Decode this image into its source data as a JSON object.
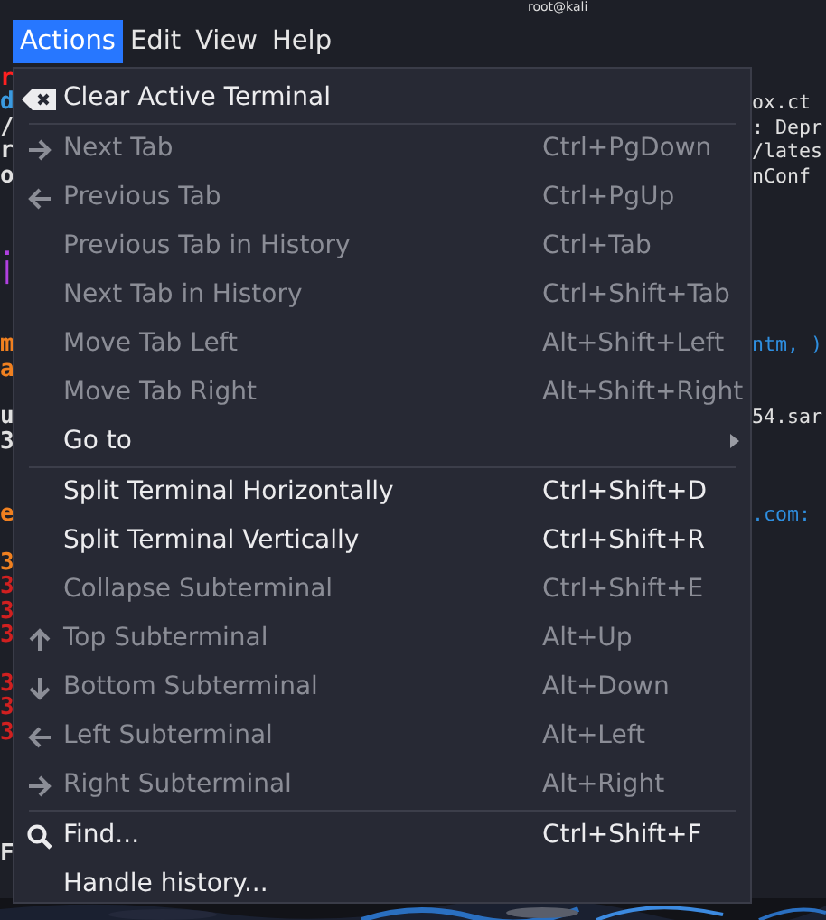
{
  "window": {
    "title": "root@kali"
  },
  "menubar": [
    {
      "label": "Actions",
      "selected": true
    },
    {
      "label": "Edit",
      "selected": false
    },
    {
      "label": "View",
      "selected": false
    },
    {
      "label": "Help",
      "selected": false
    }
  ],
  "terminal_left": [
    {
      "text": "r",
      "color": "#ff2020"
    },
    {
      "text": "d",
      "color": "#3b9ae0"
    },
    {
      "text": "/",
      "color": "#e0e0e0"
    },
    {
      "text": "r",
      "color": "#e0e0e0"
    },
    {
      "text": "o",
      "color": "#e0e0e0"
    },
    {
      "text": ".",
      "color": "#b040e0"
    },
    {
      "text": "|",
      "color": "#b040e0"
    },
    {
      "text": "m",
      "color": "#f08020"
    },
    {
      "text": "a",
      "color": "#f08020"
    },
    {
      "text": "u",
      "color": "#e0e0e0"
    },
    {
      "text": "3",
      "color": "#e0e0e0"
    },
    {
      "text": "e",
      "color": "#f08020"
    },
    {
      "text": "3",
      "color": "#f08020"
    },
    {
      "text": "3",
      "color": "#d02020"
    },
    {
      "text": "3",
      "color": "#d02020"
    },
    {
      "text": "3",
      "color": "#d02020"
    },
    {
      "text": "3",
      "color": "#d02020"
    },
    {
      "text": "3",
      "color": "#d02020"
    },
    {
      "text": "3",
      "color": "#d02020"
    },
    {
      "text": "F",
      "color": "#e0e0e0"
    }
  ],
  "terminal_right": [
    {
      "text": "ox.ct",
      "color": "#e0e0e0"
    },
    {
      "text": ": Depr",
      "color": "#e0e0e0"
    },
    {
      "text": "/lates",
      "color": "#e0e0e0"
    },
    {
      "text": "nConf",
      "color": "#e0e0e0"
    },
    {
      "text": "ntm, )",
      "color": "#2f8fe0"
    },
    {
      "text": "54.sar",
      "color": "#e0e0e0"
    },
    {
      "text": ".com:",
      "color": "#2f8fe0"
    }
  ],
  "menu": {
    "items": [
      {
        "kind": "item",
        "label": "Clear Active Terminal",
        "disabled": false
      },
      {
        "kind": "separator"
      },
      {
        "kind": "item",
        "label": "Next Tab",
        "shortcut": "Ctrl+PgDown",
        "disabled": true
      },
      {
        "kind": "item",
        "label": "Previous Tab",
        "shortcut": "Ctrl+PgUp",
        "disabled": true
      },
      {
        "kind": "item",
        "label": "Previous Tab in History",
        "shortcut": "Ctrl+Tab",
        "disabled": true
      },
      {
        "kind": "item",
        "label": "Next Tab in History",
        "shortcut": "Ctrl+Shift+Tab",
        "disabled": true
      },
      {
        "kind": "item",
        "label": "Move Tab Left",
        "shortcut": "Alt+Shift+Left",
        "disabled": true
      },
      {
        "kind": "item",
        "label": "Move Tab Right",
        "shortcut": "Alt+Shift+Right",
        "disabled": true
      },
      {
        "kind": "submenu",
        "label": "Go to",
        "disabled": false
      },
      {
        "kind": "separator"
      },
      {
        "kind": "item",
        "label": "Split Terminal Horizontally",
        "shortcut": "Ctrl+Shift+D",
        "disabled": false
      },
      {
        "kind": "item",
        "label": "Split Terminal Vertically",
        "shortcut": "Ctrl+Shift+R",
        "disabled": false
      },
      {
        "kind": "item",
        "label": "Collapse Subterminal",
        "shortcut": "Ctrl+Shift+E",
        "disabled": true
      },
      {
        "kind": "item",
        "label": "Top Subterminal",
        "shortcut": "Alt+Up",
        "disabled": true
      },
      {
        "kind": "item",
        "label": "Bottom Subterminal",
        "shortcut": "Alt+Down",
        "disabled": true
      },
      {
        "kind": "item",
        "label": "Left Subterminal",
        "shortcut": "Alt+Left",
        "disabled": true
      },
      {
        "kind": "item",
        "label": "Right Subterminal",
        "shortcut": "Alt+Right",
        "disabled": true
      },
      {
        "kind": "separator"
      },
      {
        "kind": "item",
        "label": "Find...",
        "shortcut": "Ctrl+Shift+F",
        "disabled": false
      },
      {
        "kind": "item",
        "label": "Handle history...",
        "disabled": false
      }
    ]
  }
}
